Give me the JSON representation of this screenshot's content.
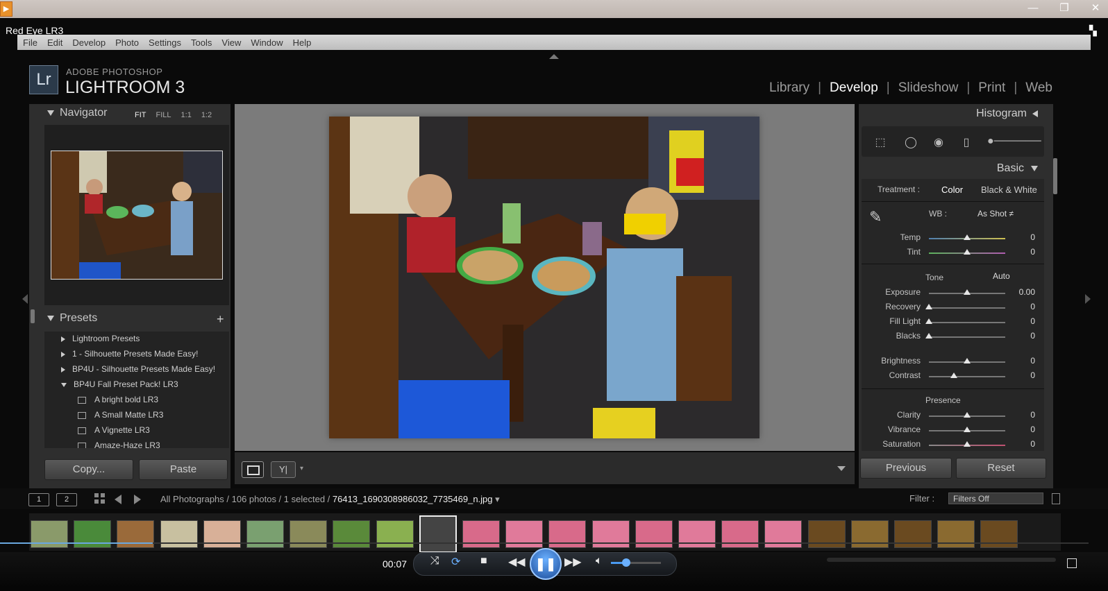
{
  "window": {
    "title": "Red Eye LR3",
    "minimize": "—",
    "maximize": "❐",
    "close": "✕"
  },
  "menubar": [
    "File",
    "Edit",
    "Develop",
    "Photo",
    "Settings",
    "Tools",
    "View",
    "Window",
    "Help"
  ],
  "header": {
    "logo": "Lr",
    "brand": "ADOBE PHOTOSHOP",
    "product": "LIGHTROOM 3",
    "modules": [
      "Library",
      "Develop",
      "Slideshow",
      "Print",
      "Web"
    ],
    "active_module": "Develop"
  },
  "navigator": {
    "title": "Navigator",
    "zooms": [
      "FIT",
      "FILL",
      "1:1",
      "1:2"
    ]
  },
  "presets": {
    "title": "Presets",
    "add": "+",
    "folders": [
      "Lightroom Presets",
      "1 - Silhouette Presets Made Easy!",
      "BP4U - Silhouette Presets Made Easy!",
      "BP4U Fall Preset Pack! LR3"
    ],
    "items": [
      "A bright bold LR3",
      "A Small Matte LR3",
      "A Vignette LR3",
      "Amaze-Haze LR3"
    ]
  },
  "left_buttons": {
    "copy": "Copy...",
    "paste": "Paste"
  },
  "right_panel": {
    "histogram": "Histogram",
    "basic": "Basic",
    "treatment_label": "Treatment :",
    "treatment_color": "Color",
    "treatment_bw": "Black & White",
    "wb_label": "WB :",
    "wb_value": "As Shot ≠",
    "tone_label": "Tone",
    "auto_label": "Auto",
    "presence_label": "Presence",
    "sliders": [
      {
        "label": "Temp",
        "value": "0",
        "level": 0.5
      },
      {
        "label": "Tint",
        "value": "0",
        "level": 0.5
      },
      {
        "label": "Exposure",
        "value": "0.00",
        "level": 0.5
      },
      {
        "label": "Recovery",
        "value": "0",
        "level": 0.0
      },
      {
        "label": "Fill Light",
        "value": "0",
        "level": 0.0
      },
      {
        "label": "Blacks",
        "value": "0",
        "level": 0.0
      },
      {
        "label": "Brightness",
        "value": "0",
        "level": 0.5
      },
      {
        "label": "Contrast",
        "value": "0",
        "level": 0.33
      },
      {
        "label": "Clarity",
        "value": "0",
        "level": 0.5
      },
      {
        "label": "Vibrance",
        "value": "0",
        "level": 0.5
      },
      {
        "label": "Saturation",
        "value": "0",
        "level": 0.5
      }
    ],
    "previous": "Previous",
    "reset": "Reset"
  },
  "filmstrip": {
    "view1": "1",
    "view2": "2",
    "source": "All Photographs / 106 photos / 1 selected / ",
    "filename": "76413_1690308986032_7735469_n.jpg",
    "filter_label": "Filter :",
    "filter_value": "Filters Off",
    "selected_index": 9
  },
  "player": {
    "time": "00:07",
    "progress": 0.14,
    "volume": 0.3
  },
  "colors": {
    "panel": "#2e2e2e",
    "canvas": "#7b7b7b",
    "accent": "#4a9af0"
  }
}
